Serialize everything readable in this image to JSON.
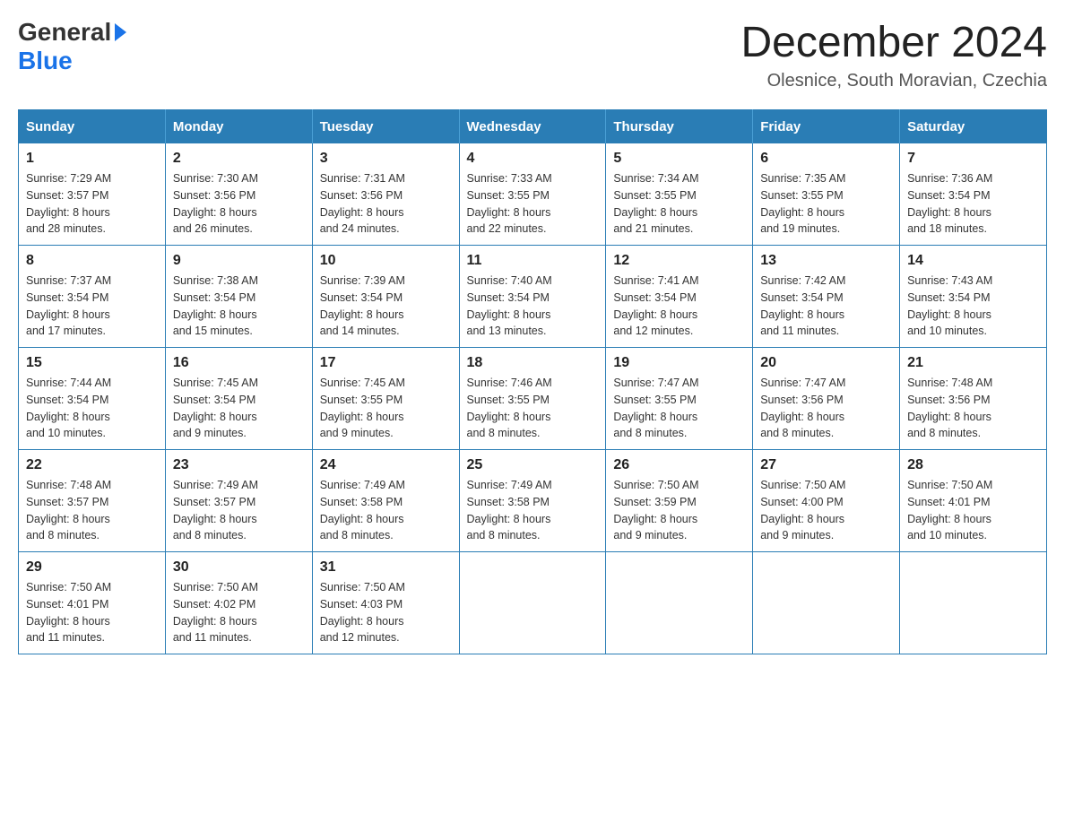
{
  "header": {
    "logo_general": "General",
    "logo_blue": "Blue",
    "month_title": "December 2024",
    "location": "Olesnice, South Moravian, Czechia"
  },
  "days_of_week": [
    "Sunday",
    "Monday",
    "Tuesday",
    "Wednesday",
    "Thursday",
    "Friday",
    "Saturday"
  ],
  "weeks": [
    [
      {
        "day": "1",
        "sunrise": "7:29 AM",
        "sunset": "3:57 PM",
        "daylight": "8 hours and 28 minutes."
      },
      {
        "day": "2",
        "sunrise": "7:30 AM",
        "sunset": "3:56 PM",
        "daylight": "8 hours and 26 minutes."
      },
      {
        "day": "3",
        "sunrise": "7:31 AM",
        "sunset": "3:56 PM",
        "daylight": "8 hours and 24 minutes."
      },
      {
        "day": "4",
        "sunrise": "7:33 AM",
        "sunset": "3:55 PM",
        "daylight": "8 hours and 22 minutes."
      },
      {
        "day": "5",
        "sunrise": "7:34 AM",
        "sunset": "3:55 PM",
        "daylight": "8 hours and 21 minutes."
      },
      {
        "day": "6",
        "sunrise": "7:35 AM",
        "sunset": "3:55 PM",
        "daylight": "8 hours and 19 minutes."
      },
      {
        "day": "7",
        "sunrise": "7:36 AM",
        "sunset": "3:54 PM",
        "daylight": "8 hours and 18 minutes."
      }
    ],
    [
      {
        "day": "8",
        "sunrise": "7:37 AM",
        "sunset": "3:54 PM",
        "daylight": "8 hours and 17 minutes."
      },
      {
        "day": "9",
        "sunrise": "7:38 AM",
        "sunset": "3:54 PM",
        "daylight": "8 hours and 15 minutes."
      },
      {
        "day": "10",
        "sunrise": "7:39 AM",
        "sunset": "3:54 PM",
        "daylight": "8 hours and 14 minutes."
      },
      {
        "day": "11",
        "sunrise": "7:40 AM",
        "sunset": "3:54 PM",
        "daylight": "8 hours and 13 minutes."
      },
      {
        "day": "12",
        "sunrise": "7:41 AM",
        "sunset": "3:54 PM",
        "daylight": "8 hours and 12 minutes."
      },
      {
        "day": "13",
        "sunrise": "7:42 AM",
        "sunset": "3:54 PM",
        "daylight": "8 hours and 11 minutes."
      },
      {
        "day": "14",
        "sunrise": "7:43 AM",
        "sunset": "3:54 PM",
        "daylight": "8 hours and 10 minutes."
      }
    ],
    [
      {
        "day": "15",
        "sunrise": "7:44 AM",
        "sunset": "3:54 PM",
        "daylight": "8 hours and 10 minutes."
      },
      {
        "day": "16",
        "sunrise": "7:45 AM",
        "sunset": "3:54 PM",
        "daylight": "8 hours and 9 minutes."
      },
      {
        "day": "17",
        "sunrise": "7:45 AM",
        "sunset": "3:55 PM",
        "daylight": "8 hours and 9 minutes."
      },
      {
        "day": "18",
        "sunrise": "7:46 AM",
        "sunset": "3:55 PM",
        "daylight": "8 hours and 8 minutes."
      },
      {
        "day": "19",
        "sunrise": "7:47 AM",
        "sunset": "3:55 PM",
        "daylight": "8 hours and 8 minutes."
      },
      {
        "day": "20",
        "sunrise": "7:47 AM",
        "sunset": "3:56 PM",
        "daylight": "8 hours and 8 minutes."
      },
      {
        "day": "21",
        "sunrise": "7:48 AM",
        "sunset": "3:56 PM",
        "daylight": "8 hours and 8 minutes."
      }
    ],
    [
      {
        "day": "22",
        "sunrise": "7:48 AM",
        "sunset": "3:57 PM",
        "daylight": "8 hours and 8 minutes."
      },
      {
        "day": "23",
        "sunrise": "7:49 AM",
        "sunset": "3:57 PM",
        "daylight": "8 hours and 8 minutes."
      },
      {
        "day": "24",
        "sunrise": "7:49 AM",
        "sunset": "3:58 PM",
        "daylight": "8 hours and 8 minutes."
      },
      {
        "day": "25",
        "sunrise": "7:49 AM",
        "sunset": "3:58 PM",
        "daylight": "8 hours and 8 minutes."
      },
      {
        "day": "26",
        "sunrise": "7:50 AM",
        "sunset": "3:59 PM",
        "daylight": "8 hours and 9 minutes."
      },
      {
        "day": "27",
        "sunrise": "7:50 AM",
        "sunset": "4:00 PM",
        "daylight": "8 hours and 9 minutes."
      },
      {
        "day": "28",
        "sunrise": "7:50 AM",
        "sunset": "4:01 PM",
        "daylight": "8 hours and 10 minutes."
      }
    ],
    [
      {
        "day": "29",
        "sunrise": "7:50 AM",
        "sunset": "4:01 PM",
        "daylight": "8 hours and 11 minutes."
      },
      {
        "day": "30",
        "sunrise": "7:50 AM",
        "sunset": "4:02 PM",
        "daylight": "8 hours and 11 minutes."
      },
      {
        "day": "31",
        "sunrise": "7:50 AM",
        "sunset": "4:03 PM",
        "daylight": "8 hours and 12 minutes."
      },
      null,
      null,
      null,
      null
    ]
  ],
  "labels": {
    "sunrise": "Sunrise:",
    "sunset": "Sunset:",
    "daylight": "Daylight:"
  }
}
